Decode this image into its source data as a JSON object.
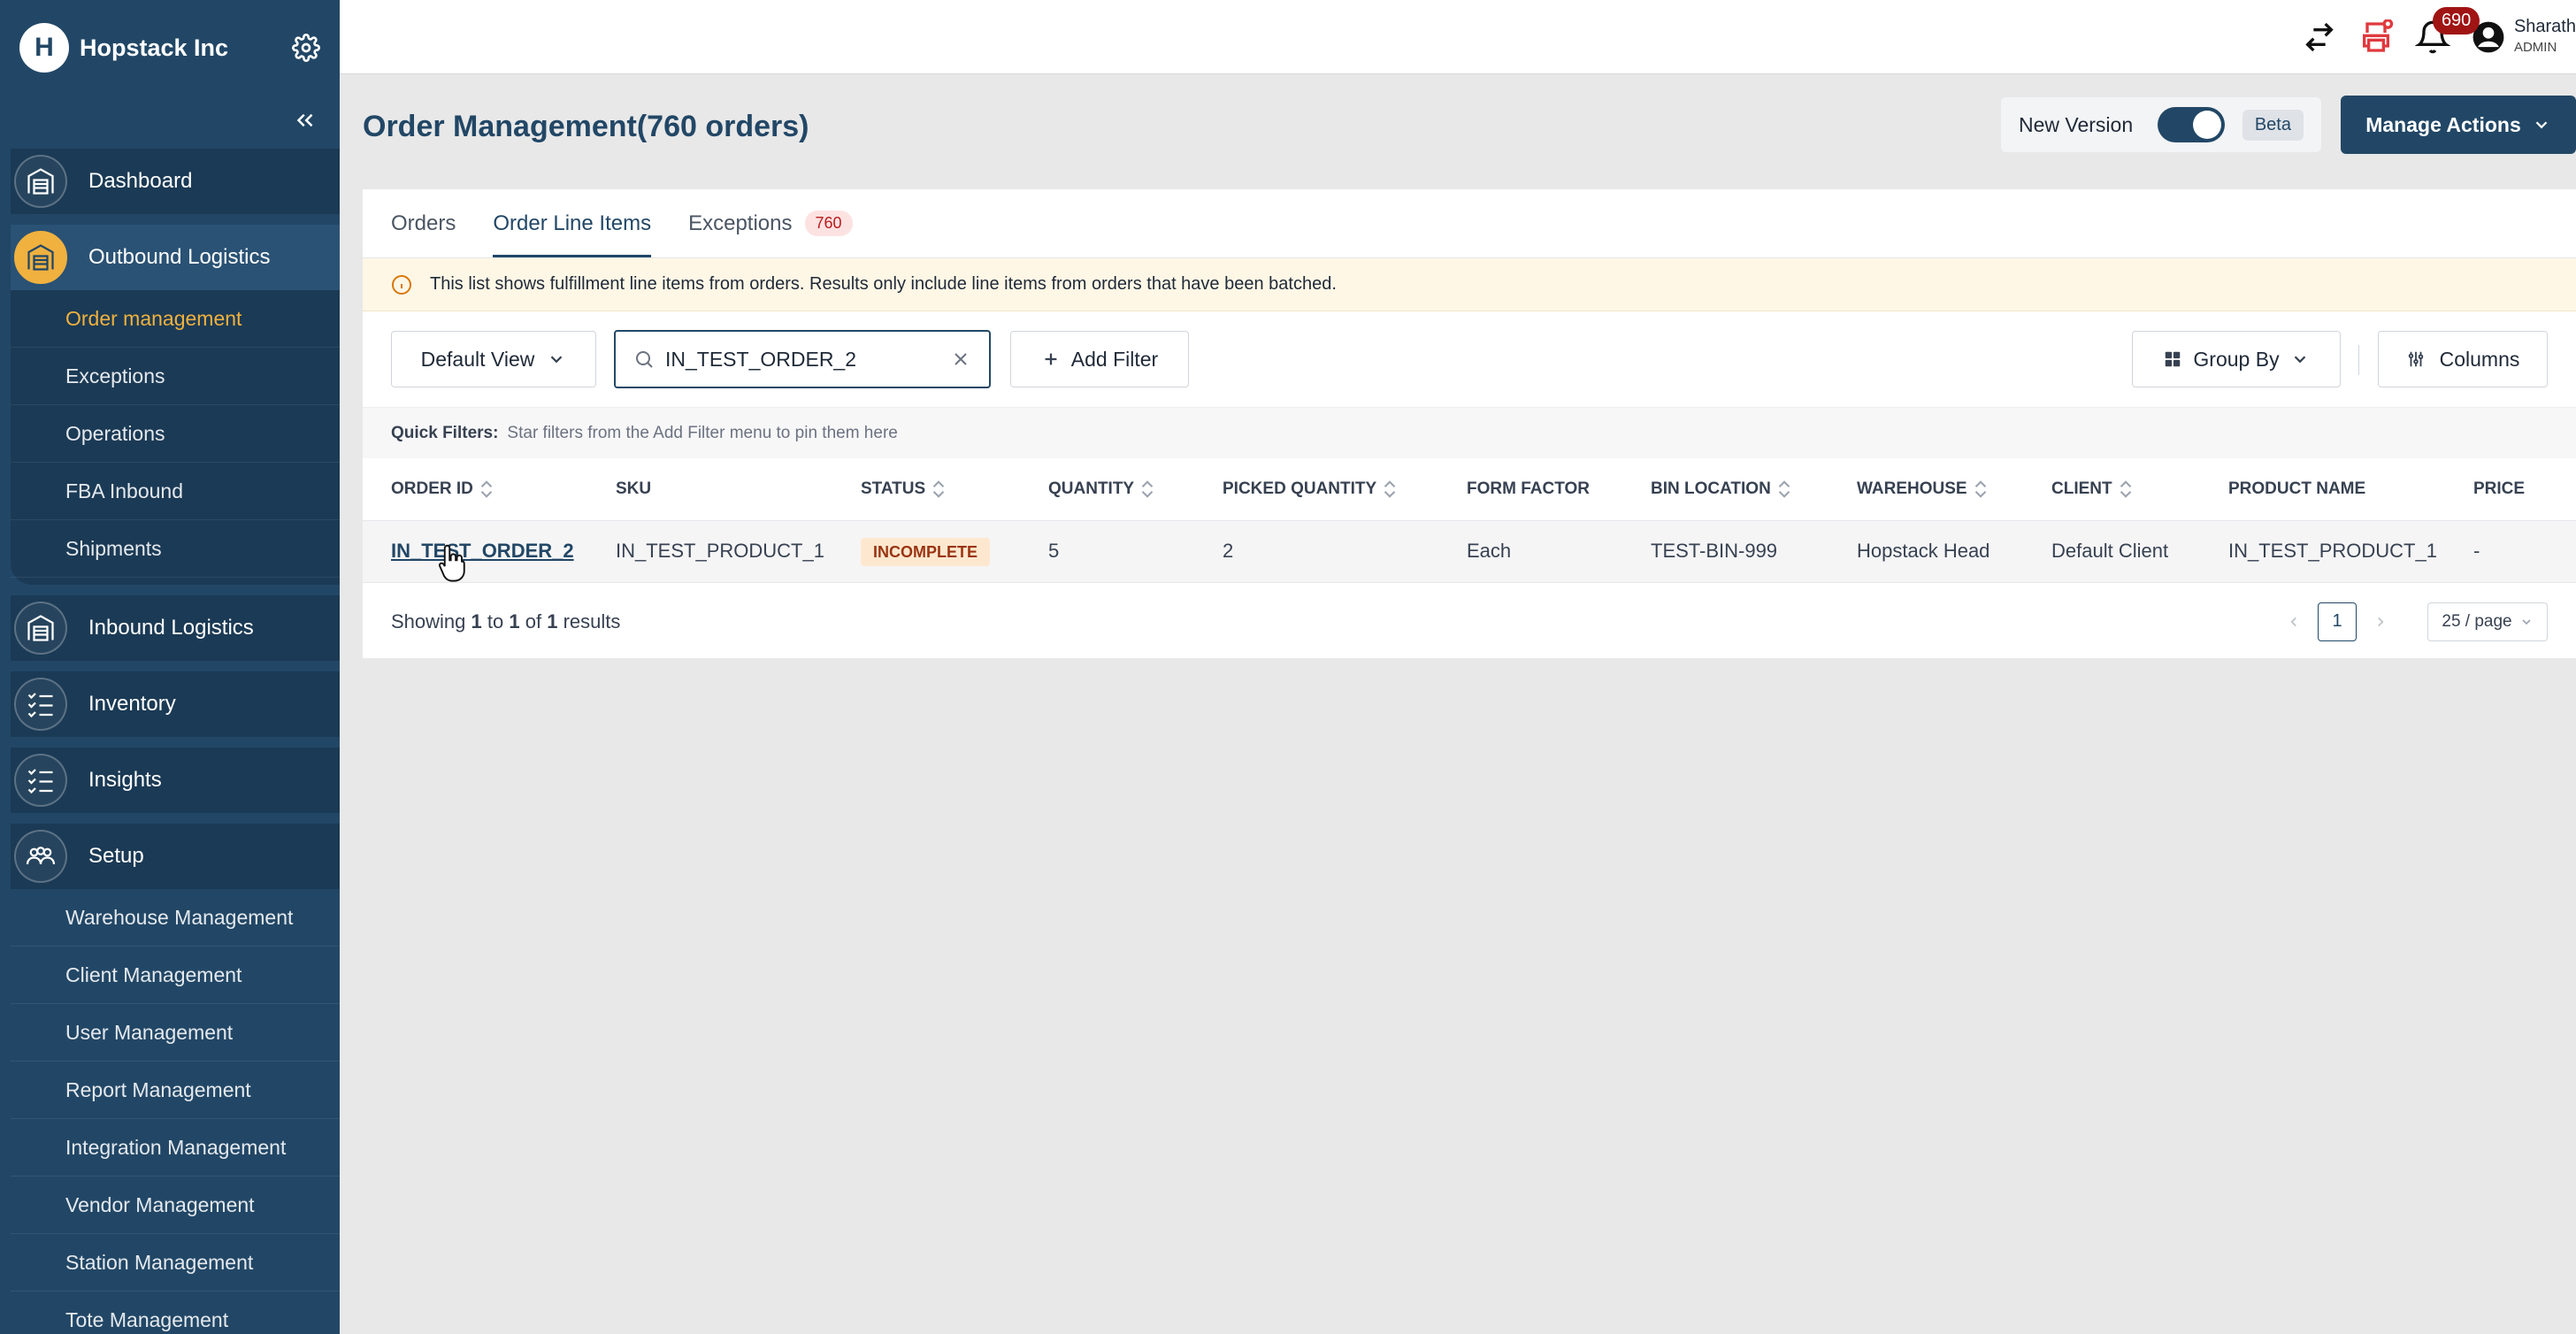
{
  "brand": {
    "name": "Hopstack Inc",
    "logo_letter": "H"
  },
  "sidebar": {
    "items": [
      {
        "label": "Dashboard",
        "icon": "warehouse-icon"
      },
      {
        "label": "Outbound Logistics",
        "icon": "warehouse-icon"
      },
      {
        "label": "Inbound Logistics",
        "icon": "warehouse-icon"
      },
      {
        "label": "Inventory",
        "icon": "checklist-icon"
      },
      {
        "label": "Insights",
        "icon": "checklist-icon"
      },
      {
        "label": "Setup",
        "icon": "team-icon"
      }
    ],
    "outbound_sub": [
      "Order management",
      "Exceptions",
      "Operations",
      "FBA Inbound",
      "Shipments"
    ],
    "setup_sub": [
      "Warehouse Management",
      "Client Management",
      "User Management",
      "Report Management",
      "Integration Management",
      "Vendor Management",
      "Station Management",
      "Tote Management"
    ]
  },
  "topbar": {
    "notification_count": "690",
    "user_name": "Sharath",
    "user_role": "ADMIN"
  },
  "header": {
    "title": "Order Management(760 orders)",
    "version_label": "New Version",
    "beta_label": "Beta",
    "manage_actions": "Manage Actions"
  },
  "tabs": [
    {
      "label": "Orders"
    },
    {
      "label": "Order Line Items"
    },
    {
      "label": "Exceptions",
      "count": "760"
    }
  ],
  "info_text": "This list shows fulfillment line items from orders. Results only include line items from orders that have been batched.",
  "toolbar": {
    "view_label": "Default View",
    "search_value": "IN_TEST_ORDER_2",
    "add_filter": "Add Filter",
    "group_by": "Group By",
    "columns": "Columns"
  },
  "quick_filters": {
    "label": "Quick Filters:",
    "hint": "Star filters from the Add Filter menu to pin them here"
  },
  "table": {
    "columns": [
      "ORDER ID",
      "SKU",
      "STATUS",
      "QUANTITY",
      "PICKED QUANTITY",
      "FORM FACTOR",
      "BIN LOCATION",
      "WAREHOUSE",
      "CLIENT",
      "PRODUCT NAME",
      "PRICE"
    ],
    "rows": [
      [
        "IN_TEST_ORDER_2",
        "IN_TEST_PRODUCT_1",
        "INCOMPLETE",
        "5",
        "2",
        "Each",
        "TEST-BIN-999",
        "Hopstack Head",
        "Default Client",
        "IN_TEST_PRODUCT_1",
        "-"
      ]
    ]
  },
  "footer": {
    "showing": "Showing",
    "from": "1",
    "to_word": "to",
    "to": "1",
    "of_word": "of",
    "total": "1",
    "results_word": "results",
    "page": "1",
    "page_size": "25 / page"
  }
}
